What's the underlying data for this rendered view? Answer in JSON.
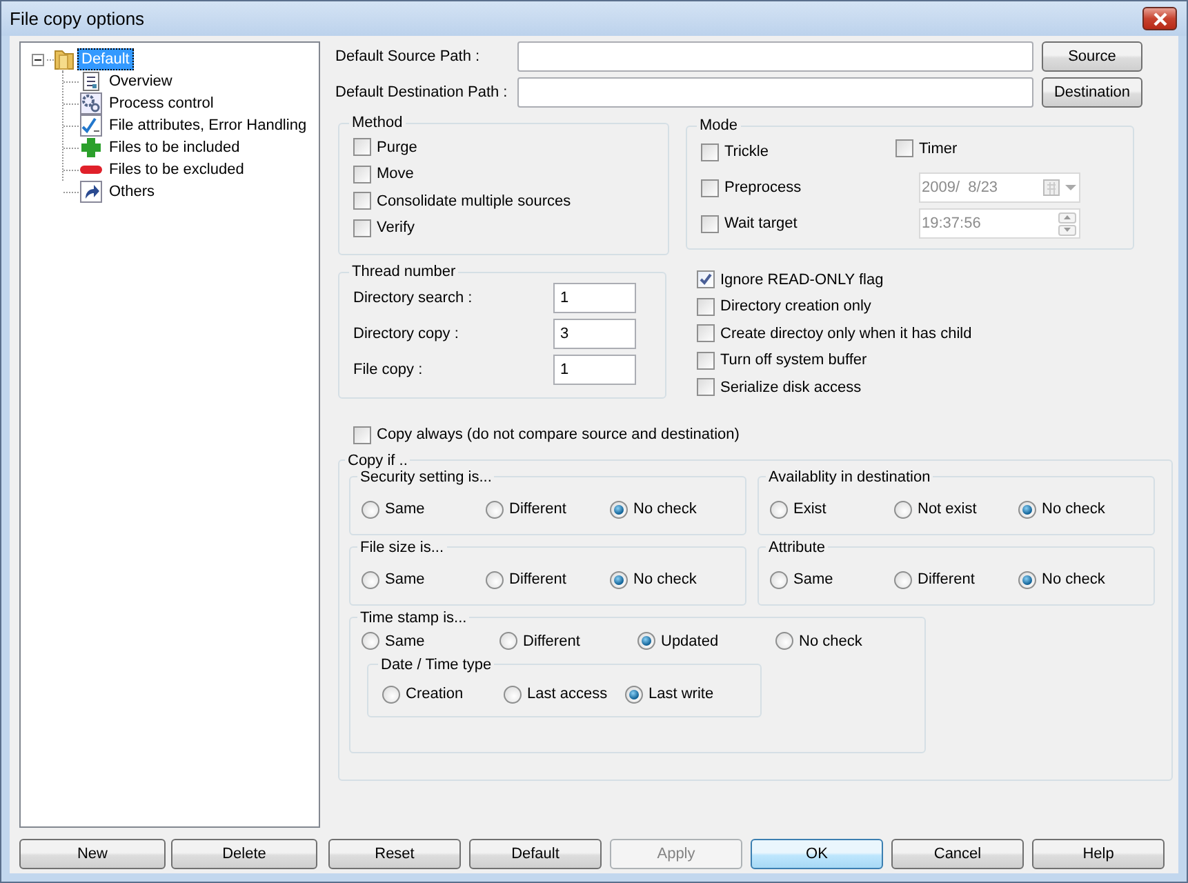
{
  "window": {
    "title": "File copy options"
  },
  "tree": {
    "label": "Default",
    "selected": true,
    "expanded": true,
    "children": [
      {
        "label": "Overview",
        "kind": "overview",
        "selected": false
      },
      {
        "label": "Process control",
        "kind": "process",
        "selected": false
      },
      {
        "label": "File attributes, Error Handling",
        "kind": "attributes",
        "selected": false
      },
      {
        "label": "Files to be included",
        "kind": "include",
        "selected": false
      },
      {
        "label": "Files to be excluded",
        "kind": "exclude",
        "selected": false
      },
      {
        "label": "Others",
        "kind": "others",
        "selected": false
      }
    ]
  },
  "paths": [
    {
      "label": "Default Source Path :",
      "button": "Source"
    },
    {
      "label": "Default Destination Path :",
      "button": "Destination"
    }
  ],
  "method": {
    "title": "Method",
    "options": [
      {
        "label": "Purge",
        "checked": false
      },
      {
        "label": "Move",
        "checked": false
      },
      {
        "label": "Consolidate multiple sources",
        "checked": false
      },
      {
        "label": "Verify",
        "checked": false
      }
    ]
  },
  "mode": {
    "title": "Mode",
    "options": [
      {
        "label": "Trickle",
        "checked": false
      },
      {
        "label": "Preprocess",
        "checked": false
      },
      {
        "label": "Wait target",
        "checked": false
      }
    ],
    "timer": {
      "label": "Timer",
      "checked": false
    },
    "date": {
      "value": "2009/  8/23",
      "disabled": true
    },
    "time": {
      "value": "19:37:56",
      "disabled": true
    }
  },
  "thread": {
    "title": "Thread number",
    "fields": [
      {
        "label": "Directory search :",
        "value": "1"
      },
      {
        "label": "Directory copy :",
        "value": "3"
      },
      {
        "label": "File copy :",
        "value": "1"
      }
    ]
  },
  "flags": [
    {
      "label": "Ignore READ-ONLY flag",
      "checked": true
    },
    {
      "label": "Directory creation only",
      "checked": false
    },
    {
      "label": "Create directoy only when it has child",
      "checked": false
    },
    {
      "label": "Turn off system buffer",
      "checked": false
    },
    {
      "label": "Serialize disk access",
      "checked": false
    }
  ],
  "copy_always": {
    "label": "Copy always (do not compare source and destination)",
    "checked": false
  },
  "copy_if": {
    "title": "Copy if ..",
    "groups": [
      {
        "title": "Security setting is...",
        "options": [
          {
            "label": "Same",
            "selected": false
          },
          {
            "label": "Different",
            "selected": false
          },
          {
            "label": "No check",
            "selected": true
          }
        ]
      },
      {
        "title": "Availablity in destination",
        "options": [
          {
            "label": "Exist",
            "selected": false
          },
          {
            "label": "Not exist",
            "selected": false
          },
          {
            "label": "No check",
            "selected": true
          }
        ]
      },
      {
        "title": "File size is...",
        "options": [
          {
            "label": "Same",
            "selected": false
          },
          {
            "label": "Different",
            "selected": false
          },
          {
            "label": "No check",
            "selected": true
          }
        ]
      },
      {
        "title": "Attribute",
        "options": [
          {
            "label": "Same",
            "selected": false
          },
          {
            "label": "Different",
            "selected": false
          },
          {
            "label": "No check",
            "selected": true
          }
        ]
      }
    ],
    "timestamp": {
      "title": "Time stamp is...",
      "options": [
        {
          "label": "Same",
          "selected": false
        },
        {
          "label": "Different",
          "selected": false
        },
        {
          "label": "Updated",
          "selected": true
        },
        {
          "label": "No check",
          "selected": false
        }
      ],
      "type": {
        "title": "Date / Time type",
        "options": [
          {
            "label": "Creation",
            "selected": false
          },
          {
            "label": "Last access",
            "selected": false
          },
          {
            "label": "Last write",
            "selected": true
          }
        ]
      }
    }
  },
  "tree_buttons": [
    {
      "label": "New",
      "disabled": false,
      "default": false
    },
    {
      "label": "Delete",
      "disabled": false,
      "default": false
    }
  ],
  "buttons": [
    {
      "label": "Reset",
      "disabled": false,
      "default": false
    },
    {
      "label": "Default",
      "disabled": false,
      "default": false
    },
    {
      "label": "Apply",
      "disabled": true,
      "default": false
    },
    {
      "label": "OK",
      "disabled": false,
      "default": true
    },
    {
      "label": "Cancel",
      "disabled": false,
      "default": false
    },
    {
      "label": "Help",
      "disabled": false,
      "default": false
    }
  ]
}
